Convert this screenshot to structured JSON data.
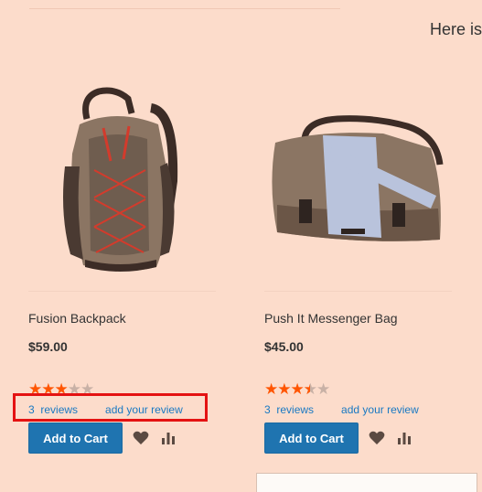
{
  "page": {
    "intro_text": "Here is"
  },
  "products": [
    {
      "name": "Fusion Backpack",
      "price": "$59.00",
      "rating_stars": 3,
      "rating_out_of": 5,
      "reviews_count": "3",
      "reviews_label": "reviews",
      "add_review_label": "add your review",
      "add_to_cart_label": "Add to Cart",
      "image_icon": "backpack-image"
    },
    {
      "name": "Push It Messenger Bag",
      "price": "$45.00",
      "rating_stars": 3.5,
      "rating_out_of": 5,
      "reviews_count": "3",
      "reviews_label": "reviews",
      "add_review_label": "add your review",
      "add_to_cart_label": "Add to Cart",
      "image_icon": "messenger-bag-image"
    }
  ],
  "icons": {
    "wishlist": "heart-icon",
    "compare": "compare-bars-icon"
  },
  "colors": {
    "page_background": "#fcdccb",
    "star_filled": "#ff5501",
    "star_empty": "#c8b1a6",
    "link": "#1979c3",
    "button": "#1f74b0",
    "highlight": "#e41212"
  }
}
